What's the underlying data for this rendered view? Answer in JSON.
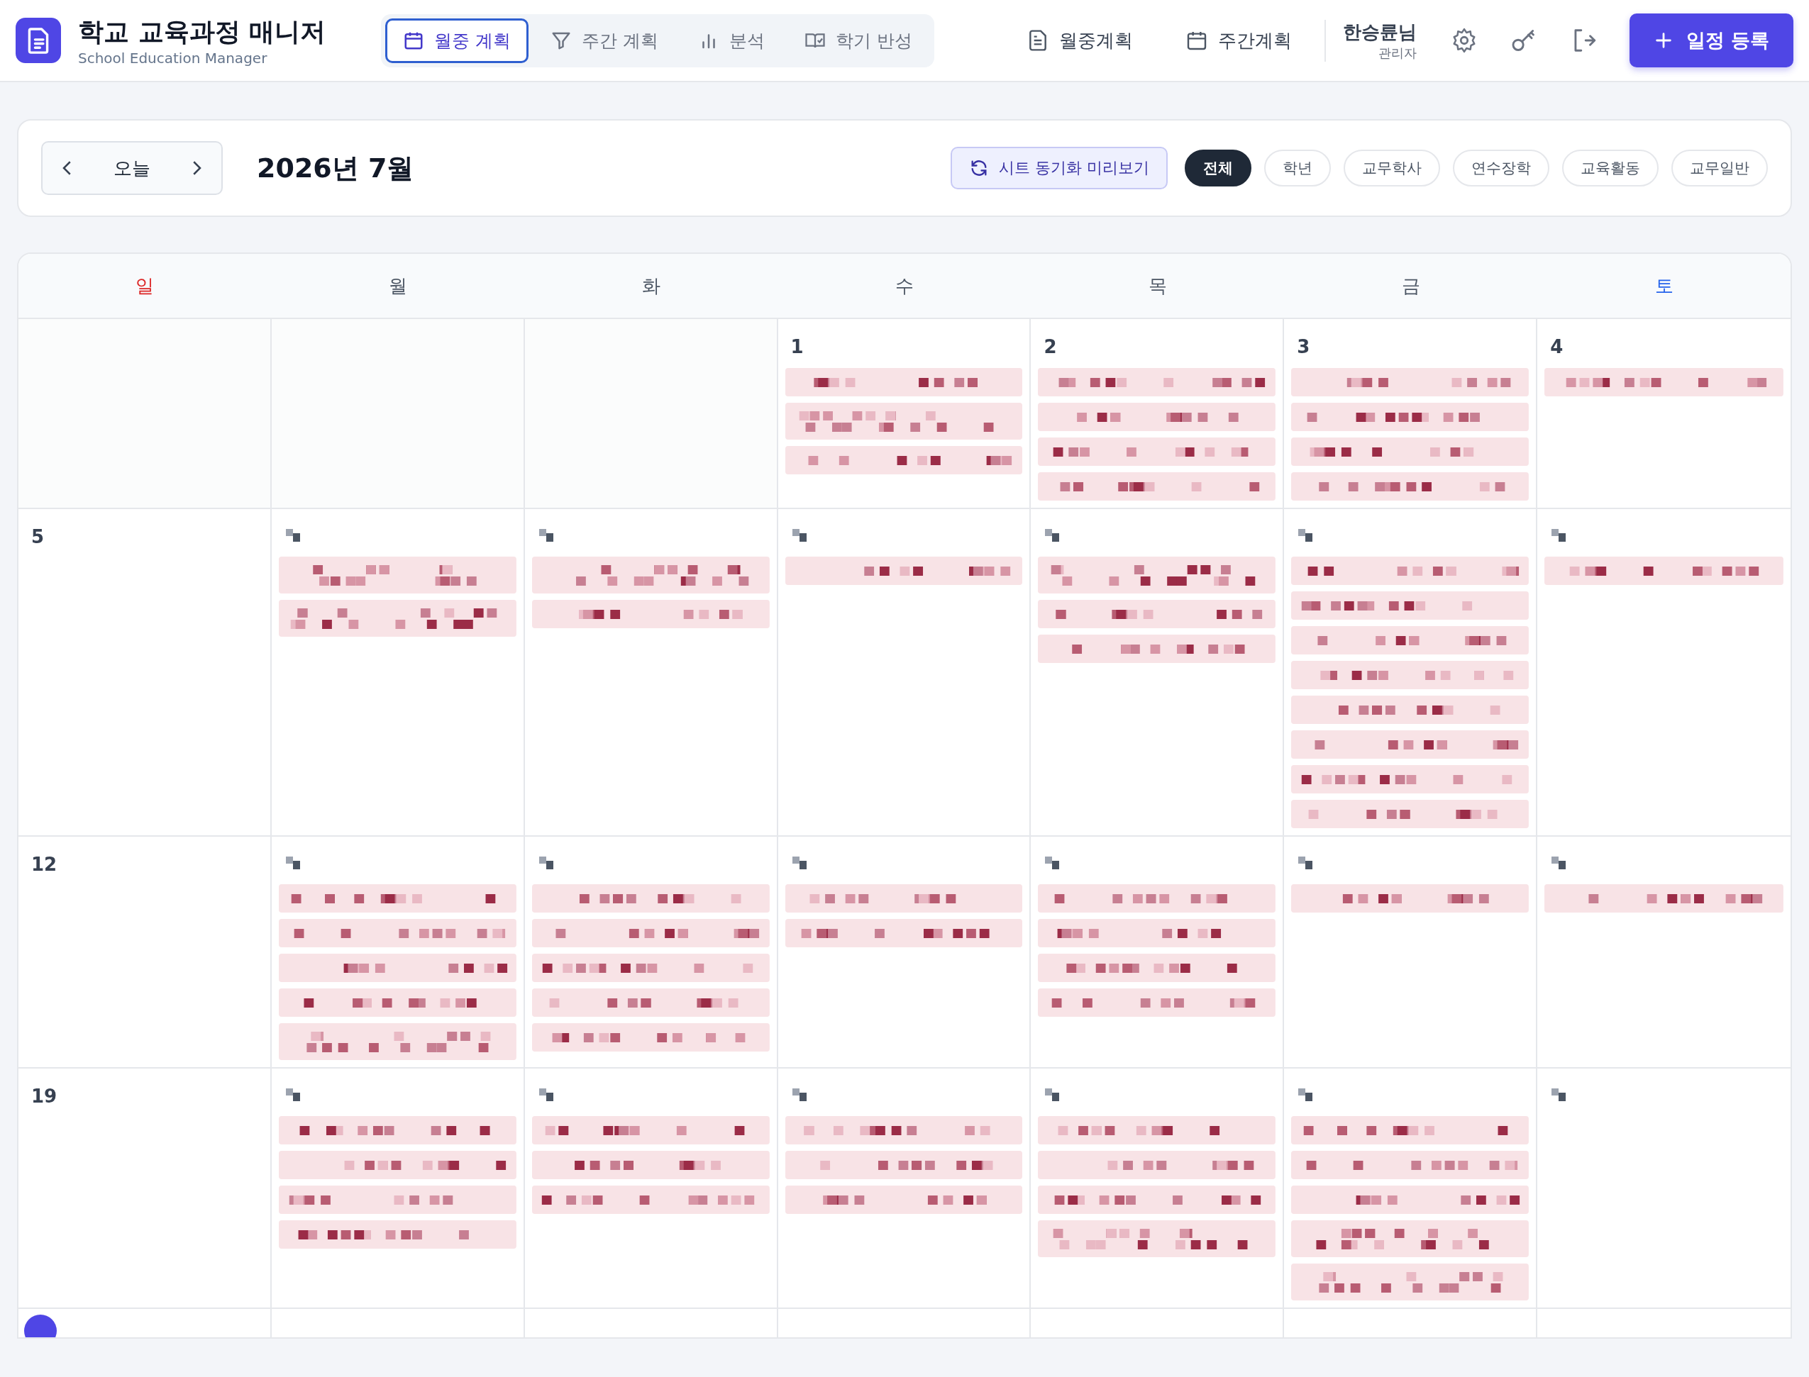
{
  "app": {
    "title": "학교 교육과정 매니저",
    "subtitle": "School Education Manager"
  },
  "view_tabs": [
    {
      "label": "월중 계획",
      "selected": true
    },
    {
      "label": "주간 계획",
      "selected": false
    },
    {
      "label": "분석",
      "selected": false
    },
    {
      "label": "학기 반성",
      "selected": false
    }
  ],
  "nav_links": [
    {
      "label": "월중계획"
    },
    {
      "label": "주간계획"
    }
  ],
  "user": {
    "name": "한승륜님",
    "role": "관리자"
  },
  "primary_button": "일정 등록",
  "toolbar": {
    "today": "오늘",
    "month": "2026년 7월",
    "sync_button": "시트 동기화 미리보기",
    "filters": [
      {
        "label": "전체",
        "selected": true
      },
      {
        "label": "학년",
        "selected": false
      },
      {
        "label": "교무학사",
        "selected": false
      },
      {
        "label": "연수장학",
        "selected": false
      },
      {
        "label": "교육활동",
        "selected": false
      },
      {
        "label": "교무일반",
        "selected": false
      }
    ]
  },
  "weekdays": [
    {
      "label": "일",
      "kind": "sunday"
    },
    {
      "label": "월",
      "kind": "weekday"
    },
    {
      "label": "화",
      "kind": "weekday"
    },
    {
      "label": "수",
      "kind": "weekday"
    },
    {
      "label": "목",
      "kind": "weekday"
    },
    {
      "label": "금",
      "kind": "weekday"
    },
    {
      "label": "토",
      "kind": "saturday"
    }
  ],
  "weeks": [
    {
      "days": [
        {
          "kind": "outside"
        },
        {
          "kind": "outside"
        },
        {
          "kind": "outside"
        },
        {
          "kind": "dated",
          "number": "1",
          "events": [
            {
              "kind": "single"
            },
            {
              "kind": "double"
            },
            {
              "kind": "single"
            }
          ]
        },
        {
          "kind": "dated",
          "number": "2",
          "events": [
            {
              "kind": "single"
            },
            {
              "kind": "single"
            },
            {
              "kind": "single"
            },
            {
              "kind": "single"
            }
          ]
        },
        {
          "kind": "dated",
          "number": "3",
          "events": [
            {
              "kind": "single"
            },
            {
              "kind": "single"
            },
            {
              "kind": "single"
            },
            {
              "kind": "single"
            }
          ]
        },
        {
          "kind": "dated",
          "number": "4",
          "events": [
            {
              "kind": "single"
            }
          ]
        }
      ]
    },
    {
      "days": [
        {
          "kind": "dated",
          "number": "5"
        },
        {
          "kind": "blurred",
          "events": [
            {
              "kind": "double"
            },
            {
              "kind": "double"
            }
          ]
        },
        {
          "kind": "blurred",
          "events": [
            {
              "kind": "double"
            },
            {
              "kind": "single"
            }
          ]
        },
        {
          "kind": "blurred",
          "events": [
            {
              "kind": "single"
            }
          ]
        },
        {
          "kind": "blurred",
          "events": [
            {
              "kind": "double"
            },
            {
              "kind": "single"
            },
            {
              "kind": "single"
            }
          ]
        },
        {
          "kind": "blurred",
          "events": [
            {
              "kind": "single"
            },
            {
              "kind": "single"
            },
            {
              "kind": "single"
            },
            {
              "kind": "single"
            },
            {
              "kind": "single"
            },
            {
              "kind": "single"
            },
            {
              "kind": "single"
            },
            {
              "kind": "single"
            }
          ]
        },
        {
          "kind": "blurred",
          "events": [
            {
              "kind": "single"
            }
          ]
        }
      ]
    },
    {
      "days": [
        {
          "kind": "dated",
          "number": "12"
        },
        {
          "kind": "blurred",
          "events": [
            {
              "kind": "single"
            },
            {
              "kind": "single"
            },
            {
              "kind": "single"
            },
            {
              "kind": "single"
            },
            {
              "kind": "double"
            }
          ]
        },
        {
          "kind": "blurred",
          "events": [
            {
              "kind": "single"
            },
            {
              "kind": "single"
            },
            {
              "kind": "single"
            },
            {
              "kind": "single"
            },
            {
              "kind": "single"
            }
          ]
        },
        {
          "kind": "blurred",
          "events": [
            {
              "kind": "single"
            },
            {
              "kind": "single"
            }
          ]
        },
        {
          "kind": "blurred",
          "events": [
            {
              "kind": "single"
            },
            {
              "kind": "single"
            },
            {
              "kind": "single"
            },
            {
              "kind": "single"
            }
          ]
        },
        {
          "kind": "blurred",
          "events": [
            {
              "kind": "single"
            }
          ]
        },
        {
          "kind": "blurred",
          "events": [
            {
              "kind": "single"
            }
          ]
        }
      ]
    },
    {
      "days": [
        {
          "kind": "dated",
          "number": "19"
        },
        {
          "kind": "blurred",
          "events": [
            {
              "kind": "single"
            },
            {
              "kind": "single"
            },
            {
              "kind": "single"
            },
            {
              "kind": "single"
            }
          ]
        },
        {
          "kind": "blurred",
          "events": [
            {
              "kind": "single"
            },
            {
              "kind": "single"
            },
            {
              "kind": "single"
            }
          ]
        },
        {
          "kind": "blurred",
          "events": [
            {
              "kind": "single"
            },
            {
              "kind": "single"
            },
            {
              "kind": "single"
            }
          ]
        },
        {
          "kind": "blurred",
          "events": [
            {
              "kind": "single"
            },
            {
              "kind": "single"
            },
            {
              "kind": "single"
            },
            {
              "kind": "double"
            }
          ]
        },
        {
          "kind": "blurred",
          "events": [
            {
              "kind": "single"
            },
            {
              "kind": "single"
            },
            {
              "kind": "single"
            },
            {
              "kind": "double"
            },
            {
              "kind": "double"
            }
          ]
        },
        {
          "kind": "blurred"
        }
      ]
    }
  ]
}
